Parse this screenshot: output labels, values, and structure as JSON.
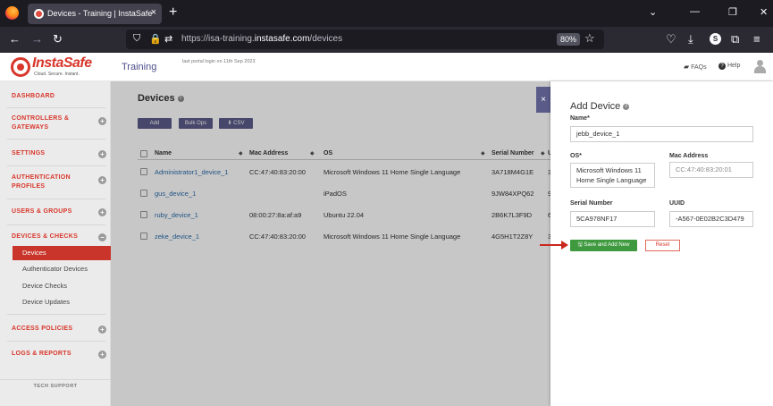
{
  "browser": {
    "tab_title": "Devices - Training | InstaSafe",
    "tab_close": "×",
    "new_tab": "+",
    "url_prefix": "https://isa-training.",
    "url_domain": "instasafe.com",
    "url_path": "/devices",
    "zoom": "80%",
    "profile_initial": "S",
    "window_controls": [
      "⌄",
      "—",
      "❐",
      "✕"
    ]
  },
  "header": {
    "logo_text": "InstaSafe",
    "logo_tagline": "Cloud. Secure. Instant.",
    "section_title": "Training",
    "last_login": "last portal login on 11th Sep 2023",
    "faqs_label": "FAQs",
    "help_label": "Help"
  },
  "sidebar": {
    "items": [
      {
        "label": "DASHBOARD",
        "toggle": ""
      },
      {
        "label": "CONTROLLERS &\nGATEWAYS",
        "toggle": "+"
      },
      {
        "label": "SETTINGS",
        "toggle": "+"
      },
      {
        "label": "AUTHENTICATION\nPROFILES",
        "toggle": "+"
      },
      {
        "label": "USERS & GROUPS",
        "toggle": "+"
      },
      {
        "label": "DEVICES & CHECKS",
        "toggle": "−"
      },
      {
        "label": "ACCESS POLICIES",
        "toggle": "+"
      },
      {
        "label": "LOGS & REPORTS",
        "toggle": "+"
      }
    ],
    "sub_items": [
      "Devices",
      "Authenticator Devices",
      "Device Checks",
      "Device Updates"
    ],
    "footer": "TECH SUPPORT"
  },
  "main": {
    "title": "Devices",
    "info": "i",
    "toolbar": {
      "add": "Add",
      "bulk": "Bulk Ops",
      "csv": "⬇ CSV"
    },
    "columns": [
      "Name",
      "Mac Address",
      "OS",
      "Serial Number",
      "U"
    ],
    "rows": [
      {
        "name": "Administrator1_device_1",
        "mac": "CC:47:40:83:20:00",
        "os": "Microsoft Windows 11 Home Single Language",
        "serial": "3A718M4G1E",
        "u": "3"
      },
      {
        "name": "gus_device_1",
        "mac": "",
        "os": "iPadOS",
        "serial": "9JW84XPQ62",
        "u": "9"
      },
      {
        "name": "ruby_device_1",
        "mac": "08:00:27:8a:af:a9",
        "os": "Ubuntu 22.04",
        "serial": "2B6K7L3F9D",
        "u": "6"
      },
      {
        "name": "zeke_device_1",
        "mac": "CC:47:40:83:20:00",
        "os": "Microsoft Windows 11 Home Single Language",
        "serial": "4G5H1T2Z8Y",
        "u": "3"
      }
    ],
    "close_label": "×"
  },
  "drawer": {
    "title": "Add Device",
    "info": "i",
    "name_label": "Name*",
    "name_value": "jebb_device_1",
    "os_label": "OS*",
    "os_value": "Microsoft Windows 11 Home Single Language",
    "mac_label": "Mac Address",
    "mac_value": "CC:47:40:83:20:01",
    "serial_label": "Serial Number",
    "serial_value": "5CA978NF17",
    "uuid_label": "UUID",
    "uuid_value": "-A567-0E02B2C3D479",
    "save_label": "Save and Add New",
    "save_icon": "🖫",
    "reset_label": "Reset"
  },
  "colors": {
    "brand": "#d8362b",
    "accent": "#5b5b8a",
    "save": "#3f9a3f"
  }
}
